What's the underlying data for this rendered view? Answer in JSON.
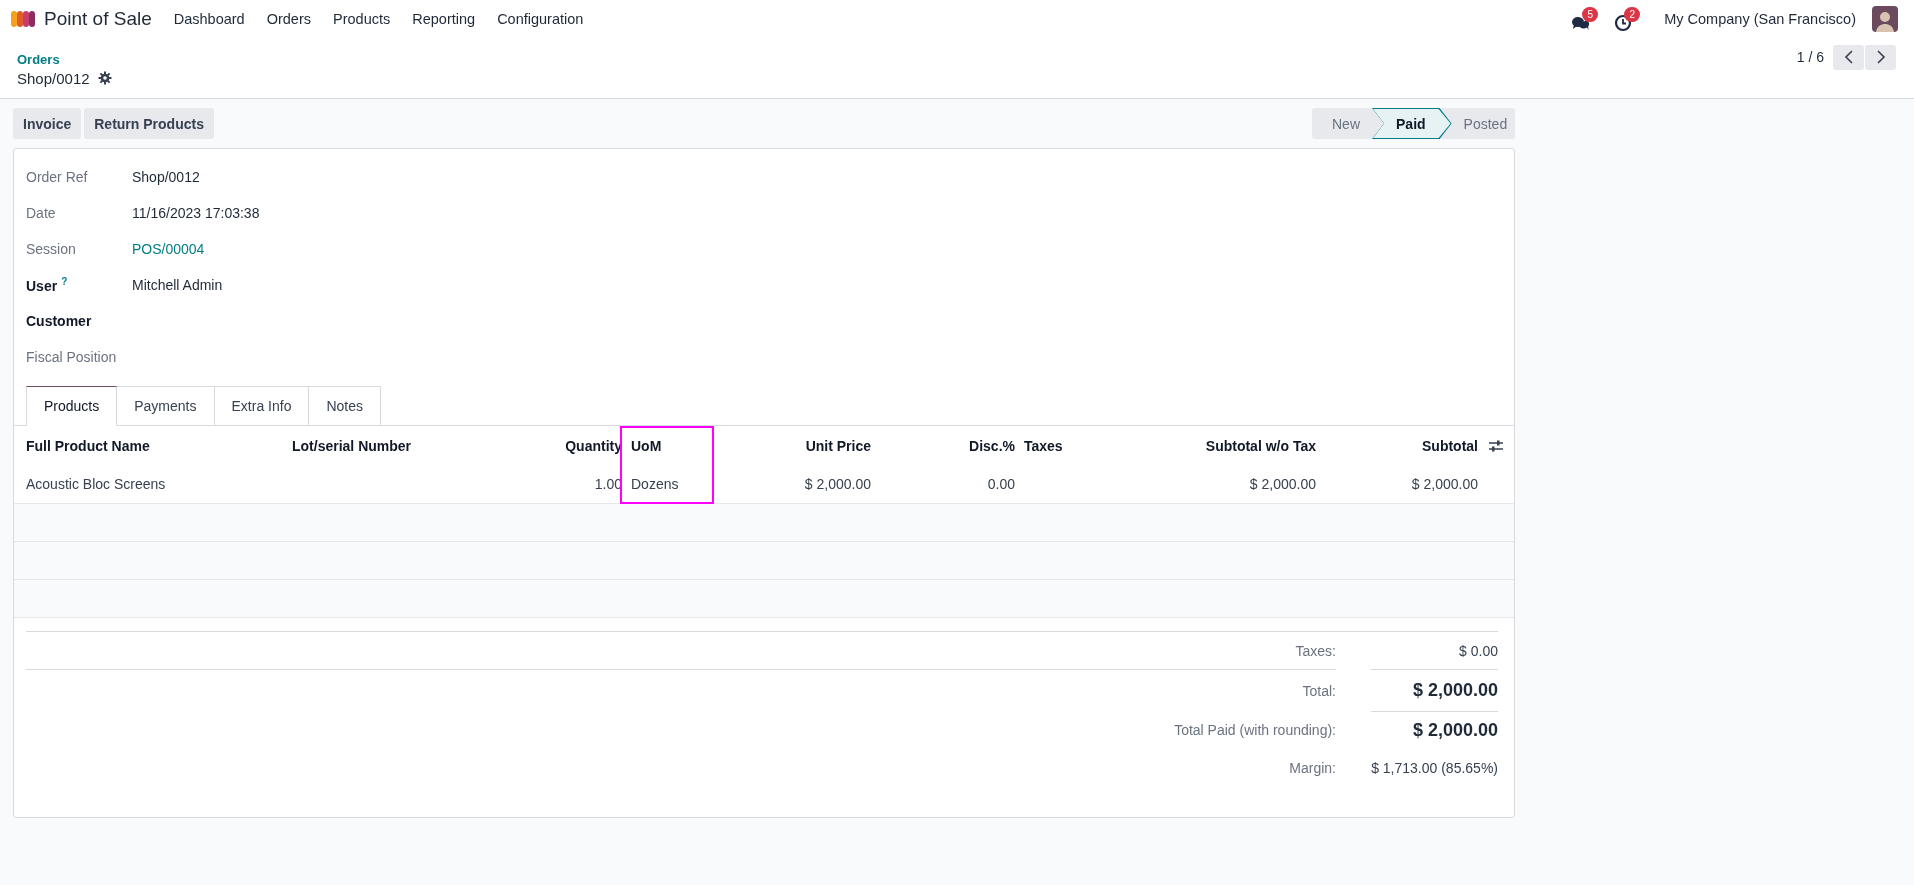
{
  "navbar": {
    "app_name": "Point of Sale",
    "menu": [
      "Dashboard",
      "Orders",
      "Products",
      "Reporting",
      "Configuration"
    ],
    "notifications": [
      {
        "kind": "messages",
        "count": "5"
      },
      {
        "kind": "activities",
        "count": "2"
      }
    ],
    "company": "My Company (San Francisco)"
  },
  "breadcrumb": {
    "parent": "Orders",
    "current": "Shop/0012"
  },
  "pager": {
    "text": "1 / 6"
  },
  "actions": [
    "Invoice",
    "Return Products"
  ],
  "status_steps": [
    {
      "label": "New",
      "selected": false
    },
    {
      "label": "Paid",
      "selected": true
    },
    {
      "label": "Posted",
      "selected": false
    }
  ],
  "fields": [
    {
      "label": "Order Ref",
      "value": "Shop/0012",
      "bold": false,
      "link": false
    },
    {
      "label": "Date",
      "value": "11/16/2023 17:03:38",
      "bold": false,
      "link": false
    },
    {
      "label": "Session",
      "value": "POS/00004",
      "bold": false,
      "link": true
    },
    {
      "label": "User",
      "help": "?",
      "value": "Mitchell Admin",
      "bold": true,
      "link": false
    },
    {
      "label": "Customer",
      "bold": true
    },
    {
      "label": "Fiscal Position",
      "bold": false
    }
  ],
  "tabs": [
    {
      "label": "Products",
      "selected": true
    },
    {
      "label": "Payments",
      "selected": false
    },
    {
      "label": "Extra Info",
      "selected": false
    },
    {
      "label": "Notes",
      "selected": false
    }
  ],
  "table": {
    "columns": [
      {
        "label": "Full Product Name",
        "highlighted": false
      },
      {
        "label": "Lot/serial Number",
        "highlighted": false
      },
      {
        "label": "Quantity",
        "highlighted": false
      },
      {
        "label": "UoM",
        "highlighted": true
      },
      {
        "label": "Unit Price",
        "highlighted": false
      },
      {
        "label": "Disc.%",
        "highlighted": false
      },
      {
        "label": "Taxes",
        "highlighted": false
      },
      {
        "label": "Subtotal w/o Tax",
        "highlighted": false
      },
      {
        "label": "Subtotal",
        "highlighted": false
      }
    ],
    "rows": [
      [
        "Acoustic Bloc Screens",
        null,
        "1.00",
        "Dozens",
        "$ 2,000.00",
        "0.00",
        null,
        "$ 2,000.00",
        "$ 2,000.00"
      ]
    ]
  },
  "totals": [
    {
      "kind": "plain",
      "rule": false,
      "label": "Taxes:",
      "value": "$ 0.00"
    },
    {
      "kind": "grand",
      "rule": true,
      "label": "Total:",
      "value": "$ 2,000.00"
    },
    {
      "kind": "grand",
      "rule": false,
      "label": "Total Paid (with rounding):",
      "value": "$ 2,000.00"
    },
    {
      "kind": "plain",
      "rule": false,
      "label": "Margin:",
      "value": "$ 1,713.00 (85.65%)"
    }
  ]
}
